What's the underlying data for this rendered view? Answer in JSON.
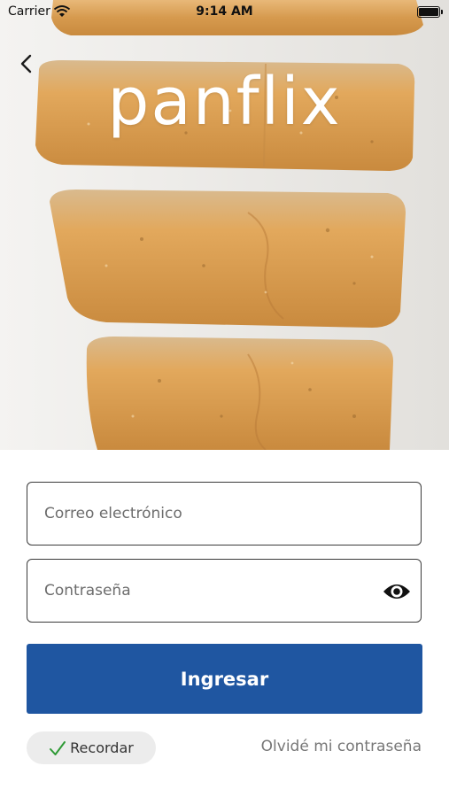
{
  "status_bar": {
    "carrier": "Carrier",
    "time": "9:14 AM"
  },
  "hero": {
    "logo_text": "panflix",
    "image_description_icon": "bread-slices-image"
  },
  "form": {
    "email": {
      "placeholder": "Correo electrónico",
      "value": ""
    },
    "password": {
      "placeholder": "Contraseña",
      "value": ""
    },
    "submit_label": "Ingresar",
    "remember_label": "Recordar",
    "remember_checked": true,
    "forgot_label": "Olvidé mi contraseña"
  },
  "icons": {
    "back": "chevron-left-icon",
    "show_password": "eye-icon",
    "remember": "checkmark-icon",
    "wifi": "wifi-icon",
    "battery": "battery-icon"
  },
  "colors": {
    "primary": "#1f56a1",
    "check": "#2e9a35",
    "pill_bg": "#ececec"
  }
}
